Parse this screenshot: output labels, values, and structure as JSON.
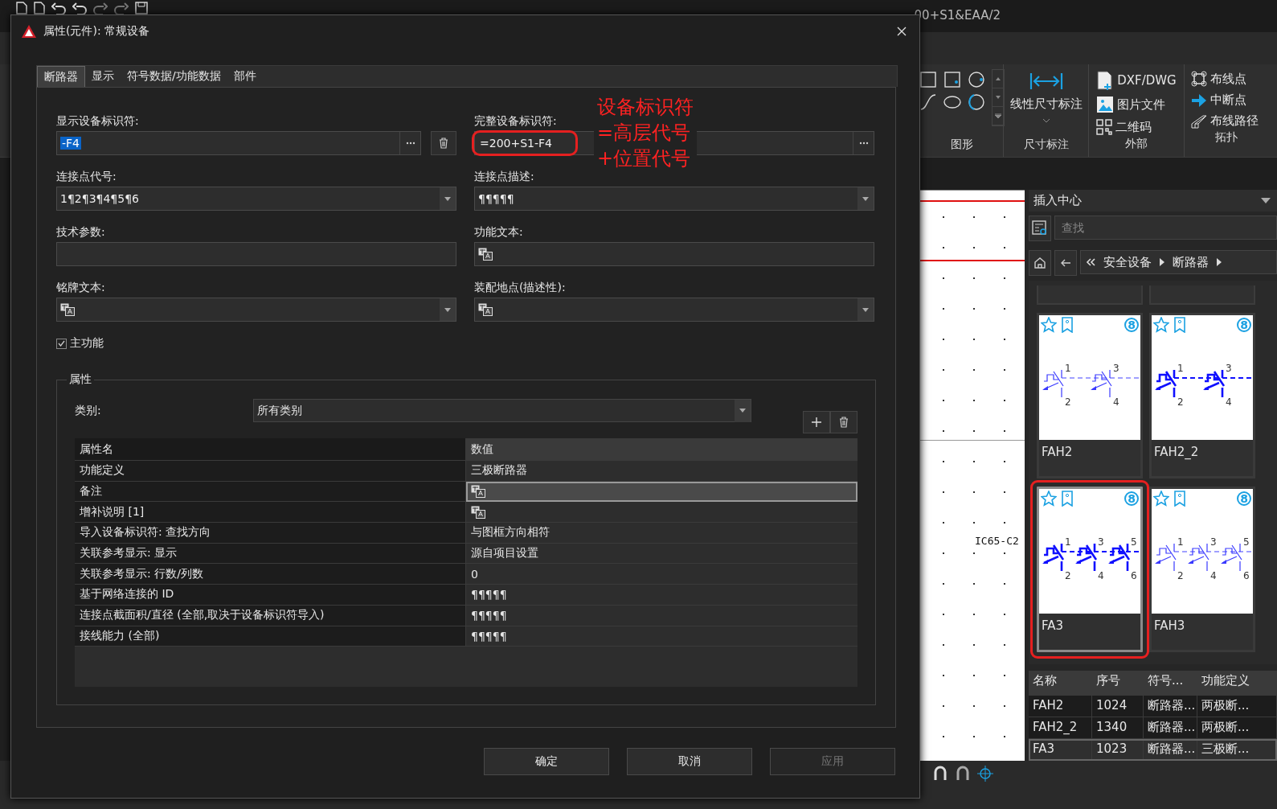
{
  "app": {
    "title_fragment": "00+S1&EAA/2",
    "ribbon": {
      "shapes_caption": "图形",
      "dimension": {
        "label": "线性尺寸标注",
        "caption": "尺寸标注"
      },
      "external": {
        "items": [
          "DXF/DWG",
          "图片文件",
          "二维码"
        ],
        "caption": "外部"
      },
      "topology": {
        "items": [
          "布线点",
          "中断点",
          "布线路径"
        ],
        "caption": "拓扑"
      }
    },
    "canvas": {
      "label": "IC65-C2"
    },
    "insert_center": {
      "title": "插入中心",
      "search": {
        "placeholder": "查找"
      },
      "breadcrumb": [
        "安全设备",
        "断路器"
      ],
      "tiles": [
        {
          "name": "FAH2",
          "badge": "8",
          "terminals": [
            "1",
            "2",
            "3",
            "4"
          ],
          "bold": false,
          "selected": false,
          "marked": false
        },
        {
          "name": "FAH2_2",
          "badge": "8",
          "terminals": [
            "1",
            "2",
            "3",
            "4"
          ],
          "bold": true,
          "selected": false,
          "marked": false
        },
        {
          "name": "FA3",
          "badge": "8",
          "terminals": [
            "1",
            "2",
            "3",
            "4",
            "5",
            "6"
          ],
          "bold": true,
          "selected": true,
          "marked": true
        },
        {
          "name": "FAH3",
          "badge": "8",
          "terminals": [
            "1",
            "2",
            "3",
            "4",
            "5",
            "6"
          ],
          "bold": false,
          "selected": false,
          "marked": false
        }
      ],
      "table": {
        "columns": [
          "名称",
          "序号",
          "符号...",
          "功能定义"
        ],
        "rows": [
          {
            "cells": [
              "FAH2",
              "1024",
              "断路器...",
              "两极断..."
            ],
            "selected": false
          },
          {
            "cells": [
              "FAH2_2",
              "1340",
              "断路器...",
              "两极断..."
            ],
            "selected": false
          },
          {
            "cells": [
              "FA3",
              "1023",
              "断路器...",
              "三极断..."
            ],
            "selected": true
          }
        ]
      }
    }
  },
  "dialog": {
    "title": "属性(元件): 常规设备",
    "tabs": [
      {
        "label": "断路器",
        "selected": true
      },
      {
        "label": "显示",
        "selected": false
      },
      {
        "label": "符号数据/功能数据",
        "selected": false
      },
      {
        "label": "部件",
        "selected": false
      }
    ],
    "fields": [
      {
        "label": "显示设备标识符:",
        "kind": "picker",
        "value": "-F4",
        "highlighted": true,
        "delete": true,
        "marked": false
      },
      {
        "label": "完整设备标识符:",
        "kind": "picker",
        "value": "=200+S1-F4",
        "highlighted": false,
        "delete": false,
        "marked": true
      },
      {
        "label": "连接点代号:",
        "kind": "dropdown",
        "value": "1¶2¶3¶4¶5¶6",
        "translate": false
      },
      {
        "label": "连接点描述:",
        "kind": "dropdown",
        "value": "¶¶¶¶¶",
        "translate": false
      },
      {
        "label": "技术参数:",
        "kind": "text",
        "translate": false
      },
      {
        "label": "功能文本:",
        "kind": "text",
        "translate": true
      },
      {
        "label": "铭牌文本:",
        "kind": "dropdown",
        "translate": true
      },
      {
        "label": "装配地点(描述性):",
        "kind": "dropdown",
        "translate": true
      }
    ],
    "main_function": {
      "label": "主功能",
      "checked": true
    },
    "annotation": [
      "设备标识符",
      "=高层代号",
      "+位置代号"
    ],
    "properties": {
      "title": "属性",
      "category": {
        "label": "类别:",
        "value": "所有类别"
      },
      "columns": [
        "属性名",
        "数值"
      ],
      "rows": [
        {
          "name": "功能定义",
          "kind": "text",
          "value": "三极断路器",
          "selected": false
        },
        {
          "name": "备注",
          "kind": "translate",
          "selected": true
        },
        {
          "name": "增补说明 [1]",
          "kind": "translate",
          "selected": false
        },
        {
          "name": "导入设备标识符: 查找方向",
          "kind": "text",
          "value": "与图框方向相符",
          "selected": false
        },
        {
          "name": "关联参考显示: 显示",
          "kind": "text",
          "value": "源自项目设置",
          "selected": false
        },
        {
          "name": "关联参考显示: 行数/列数",
          "kind": "text",
          "value": "0",
          "selected": false
        },
        {
          "name": "基于网络连接的 ID",
          "kind": "text",
          "value": "¶¶¶¶¶",
          "selected": false
        },
        {
          "name": "连接点截面积/直径 (全部,取决于设备标识符导入)",
          "kind": "text",
          "value": "¶¶¶¶¶",
          "selected": false
        },
        {
          "name": "接线能力 (全部)",
          "kind": "text",
          "value": "¶¶¶¶¶",
          "selected": false
        }
      ]
    },
    "buttons": [
      {
        "label": "确定",
        "disabled": false
      },
      {
        "label": "取消",
        "disabled": false
      },
      {
        "label": "应用",
        "disabled": true
      }
    ]
  }
}
